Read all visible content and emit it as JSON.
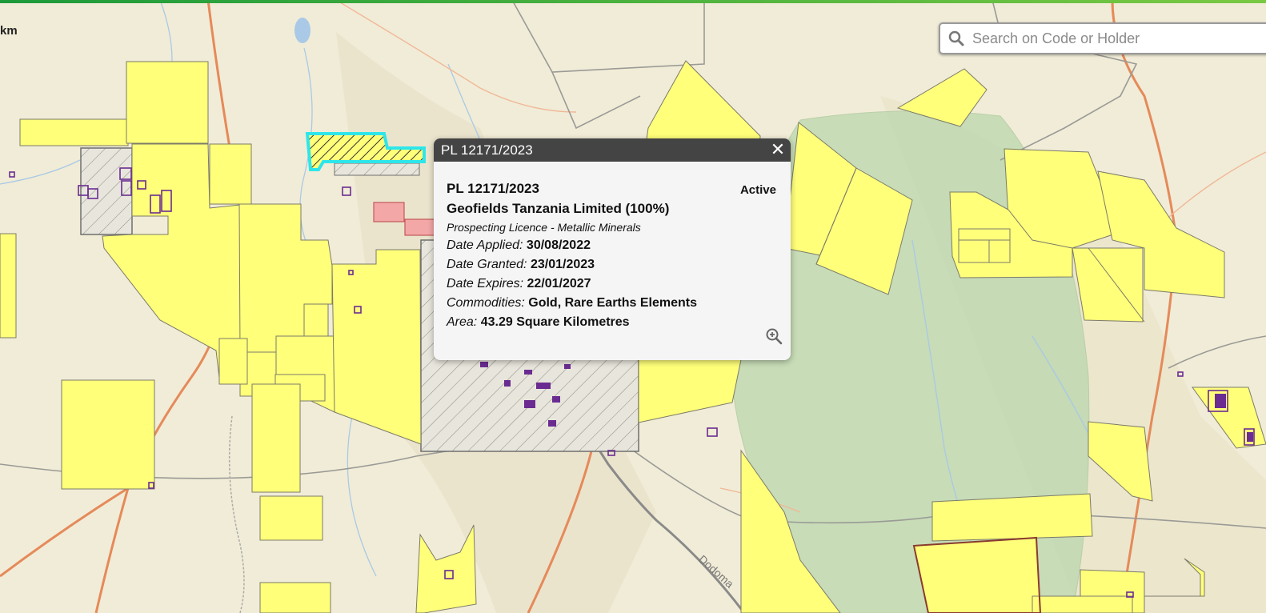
{
  "map": {
    "scale_unit": "km",
    "place_labels": [
      "Dodoma"
    ]
  },
  "search": {
    "placeholder": "Search on Code or Holder",
    "icon": "search-icon"
  },
  "popup": {
    "title": "PL 12171/2023",
    "licence_code": "PL 12171/2023",
    "status": "Active",
    "holder": "Geofields Tanzania Limited (100%)",
    "licence_type": "Prospecting Licence - Metallic Minerals",
    "fields": [
      {
        "label": "Date Applied:",
        "value": "30/08/2022"
      },
      {
        "label": "Date Granted:",
        "value": "23/01/2023"
      },
      {
        "label": "Date Expires:",
        "value": "22/01/2027"
      },
      {
        "label": "Commodities:",
        "value": "Gold, Rare Earths Elements"
      },
      {
        "label": "Area:",
        "value": "43.29 Square Kilometres"
      }
    ],
    "close_icon": "close-icon",
    "zoom_icon": "zoom-in-icon"
  },
  "colors": {
    "licence_fill": "#ffff7a",
    "selected_outline": "#2ee6ea",
    "application_fill": "#f4a7a7",
    "reserve_fill": "#b9d7ad",
    "small_claims": "#6a2c91",
    "road": "#e58a5a",
    "header_bar": "#1c9a3a"
  }
}
